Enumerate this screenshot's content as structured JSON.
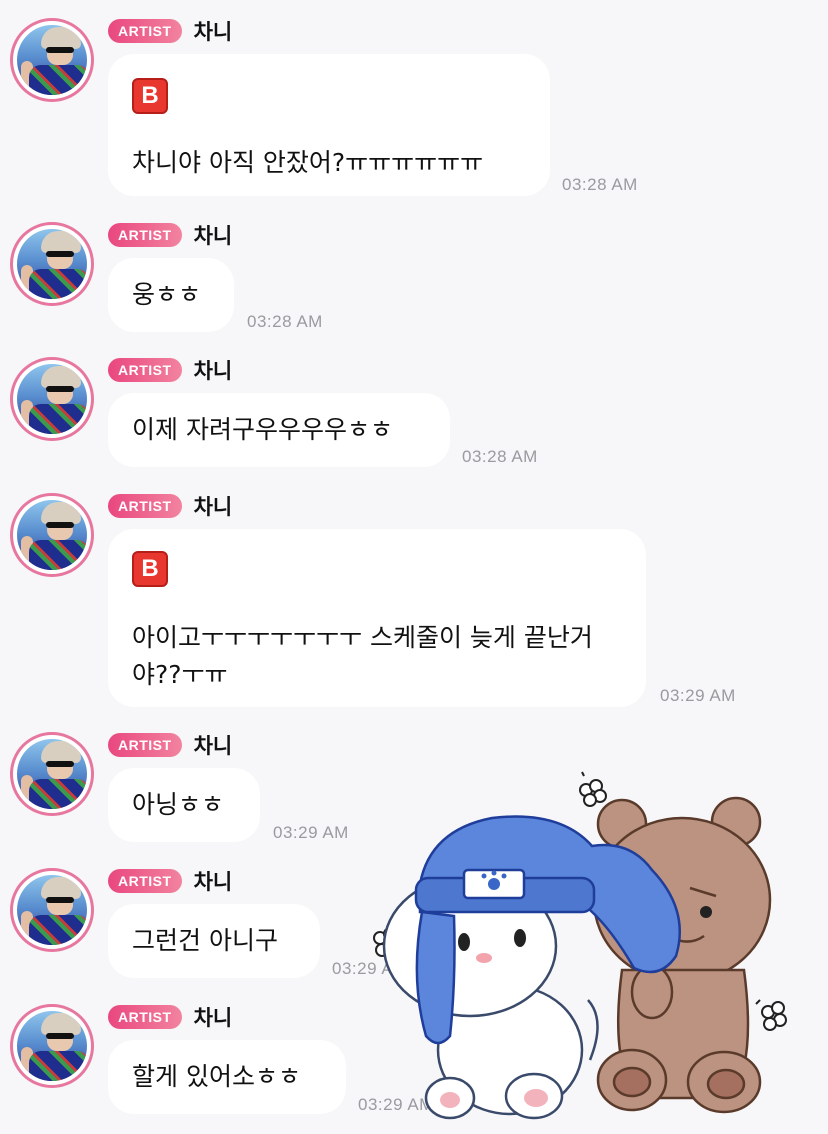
{
  "messages": [
    {
      "badge": "ARTIST",
      "name": "차니",
      "icon_label": "B",
      "text": "차니야 아직 안잤어?ㅠㅠㅠㅠㅠㅠ",
      "time": "03:28 AM"
    },
    {
      "badge": "ARTIST",
      "name": "차니",
      "text": "웅ㅎㅎ",
      "time": "03:28 AM"
    },
    {
      "badge": "ARTIST",
      "name": "차니",
      "text": "이제 자려구우우우우ㅎㅎ",
      "time": "03:28 AM"
    },
    {
      "badge": "ARTIST",
      "name": "차니",
      "icon_label": "B",
      "text_line1": "아이고ㅜㅜㅜㅜㅜㅜㅜ 스케줄이 늦게 끝난거",
      "text_line2": "야??ㅜㅠ",
      "time": "03:29 AM"
    },
    {
      "badge": "ARTIST",
      "name": "차니",
      "text": "아닝ㅎㅎ",
      "time": "03:29 AM"
    },
    {
      "badge": "ARTIST",
      "name": "차니",
      "text": "그런건 아니구",
      "time": "03:29 AM"
    },
    {
      "badge": "ARTIST",
      "name": "차니",
      "text": "할게 있어소ㅎㅎ",
      "time": "03:29 AM"
    }
  ],
  "colors": {
    "badge_start": "#e9477f",
    "badge_end": "#f2839f",
    "avatar_ring": "#e7779e",
    "background": "#f7f7f9",
    "bubble": "#ffffff",
    "timestamp": "#9a9aa0"
  },
  "sticker": {
    "icon": "bunny-and-bear-sticker"
  }
}
